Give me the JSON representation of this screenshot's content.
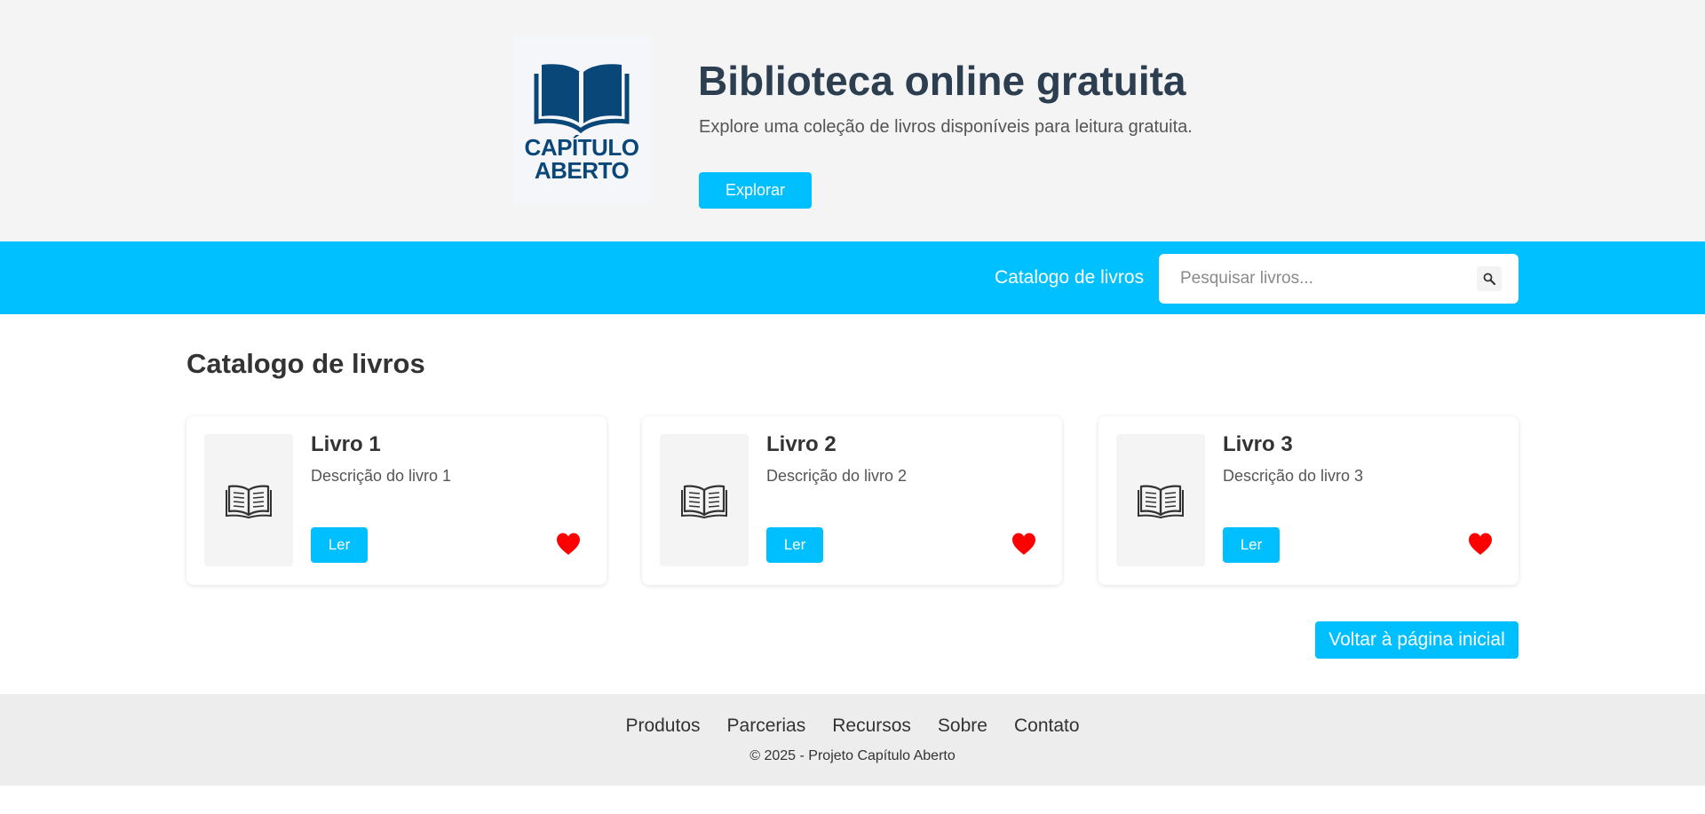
{
  "hero": {
    "logo_line1": "CAPÍTULO",
    "logo_line2": "ABERTO",
    "title": "Biblioteca online gratuita",
    "subtitle": "Explore uma coleção de livros disponíveis para leitura gratuita.",
    "explore_label": "Explorar"
  },
  "navbar": {
    "catalog_link": "Catalogo de livros",
    "search_placeholder": "Pesquisar livros...",
    "search_value": ""
  },
  "catalog": {
    "title": "Catalogo de livros",
    "books": [
      {
        "title": "Livro 1",
        "description": "Descrição do livro 1",
        "read_label": "Ler"
      },
      {
        "title": "Livro 2",
        "description": "Descrição do livro 2",
        "read_label": "Ler"
      },
      {
        "title": "Livro 3",
        "description": "Descrição do livro 3",
        "read_label": "Ler"
      }
    ],
    "back_label": "Voltar à página inicial"
  },
  "footer": {
    "links": [
      "Produtos",
      "Parcerias",
      "Recursos",
      "Sobre",
      "Contato"
    ],
    "copyright": "© 2025 - Projeto Capítulo Aberto"
  },
  "colors": {
    "accent": "#00bfff",
    "heading": "#2c3e50",
    "logo": "#0a4779",
    "heart": "#ff0000"
  },
  "icons": {
    "logo": "open-book-logo",
    "search": "search-icon",
    "book": "book-icon",
    "favorite": "heart-icon"
  }
}
